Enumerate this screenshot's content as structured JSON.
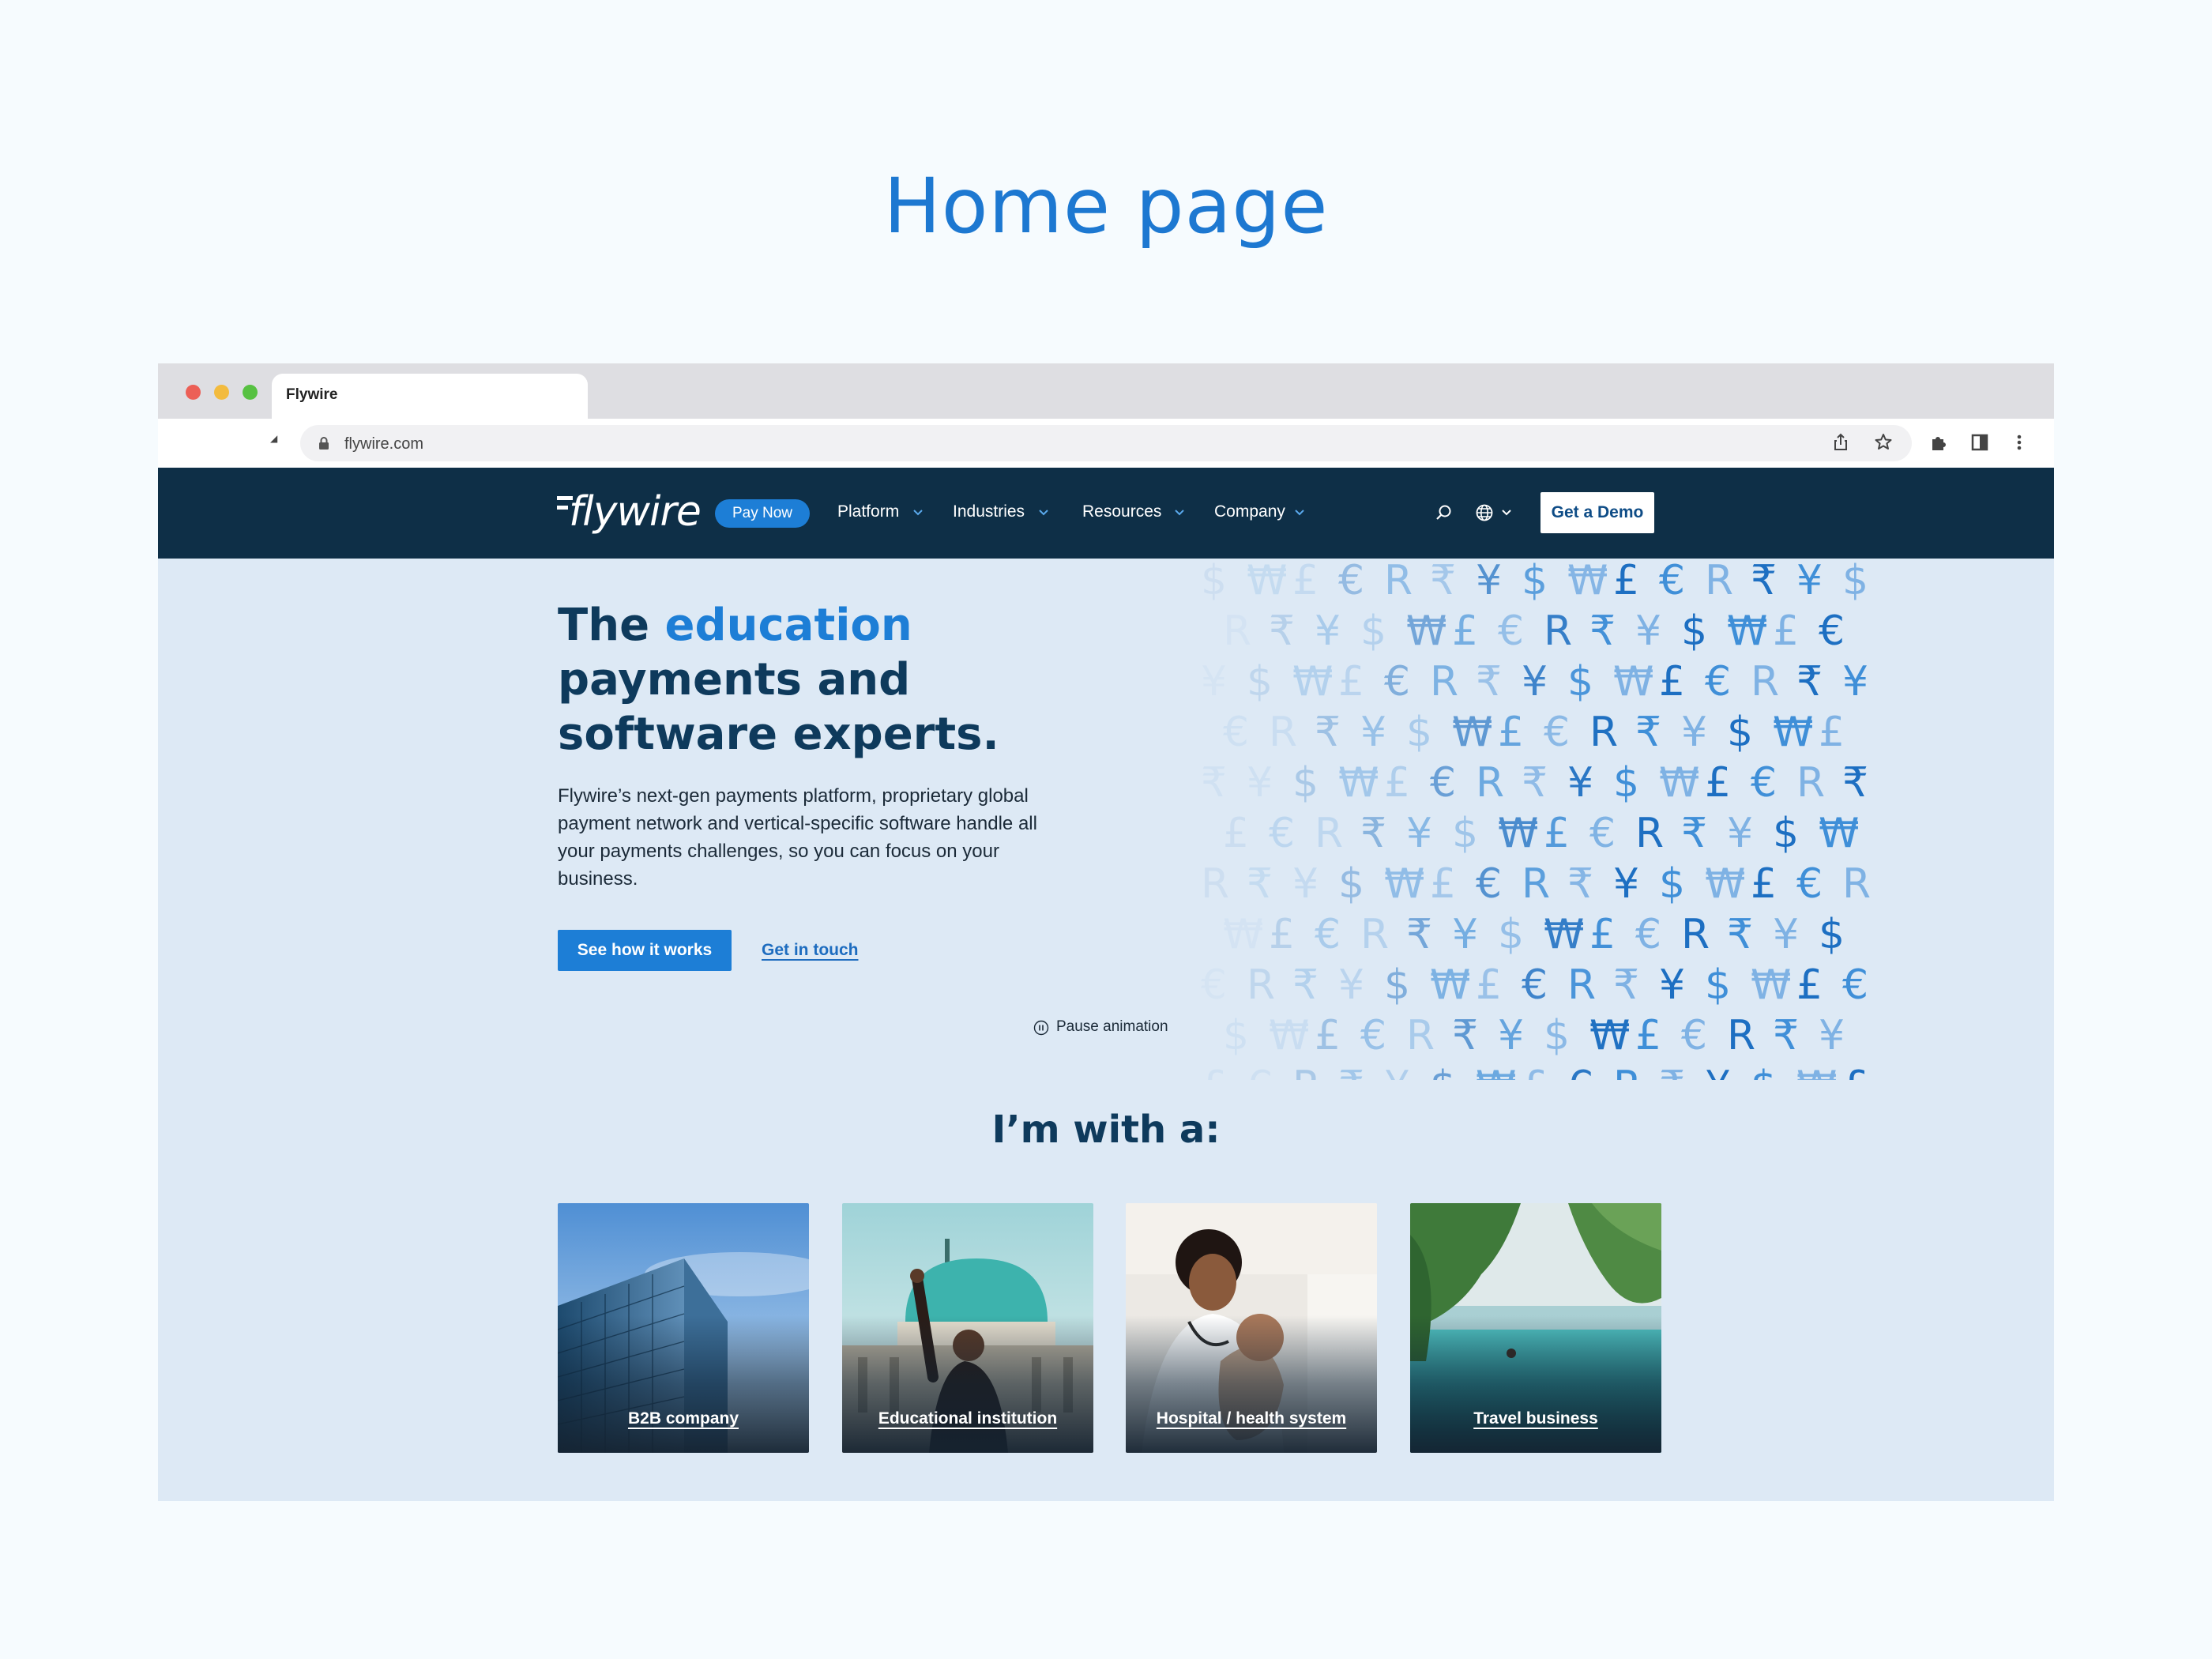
{
  "page_heading": "Home page",
  "browser": {
    "tab_title": "Flywire",
    "url": "flywire.com"
  },
  "nav": {
    "logo_text": "flywire",
    "pay_now": "Pay Now",
    "items": [
      "Platform",
      "Industries",
      "Resources",
      "Company"
    ],
    "cta": "Get a Demo"
  },
  "hero": {
    "title_part1": "The ",
    "title_highlight": "education",
    "title_part2": " payments and software experts.",
    "body": "Flywire’s next-gen payments platform, proprietary global payment network and vertical-specific software handle all your payments challenges, so you can focus on your business.",
    "primary_cta": "See how it works",
    "secondary_cta": "Get in touch",
    "pause_label": "Pause animation",
    "currency_sequence": "$₩£€R₹¥"
  },
  "segments": {
    "heading": "I’m with a:",
    "cards": [
      {
        "label": "B2B company"
      },
      {
        "label": "Educational institution"
      },
      {
        "label": "Hospital / health system"
      },
      {
        "label": "Travel business"
      }
    ]
  },
  "colors": {
    "accent_blue": "#1d7ed6",
    "nav_navy": "#0e2f47",
    "heading_navy": "#0e3a5c",
    "hero_bg": "#dde9f5"
  }
}
